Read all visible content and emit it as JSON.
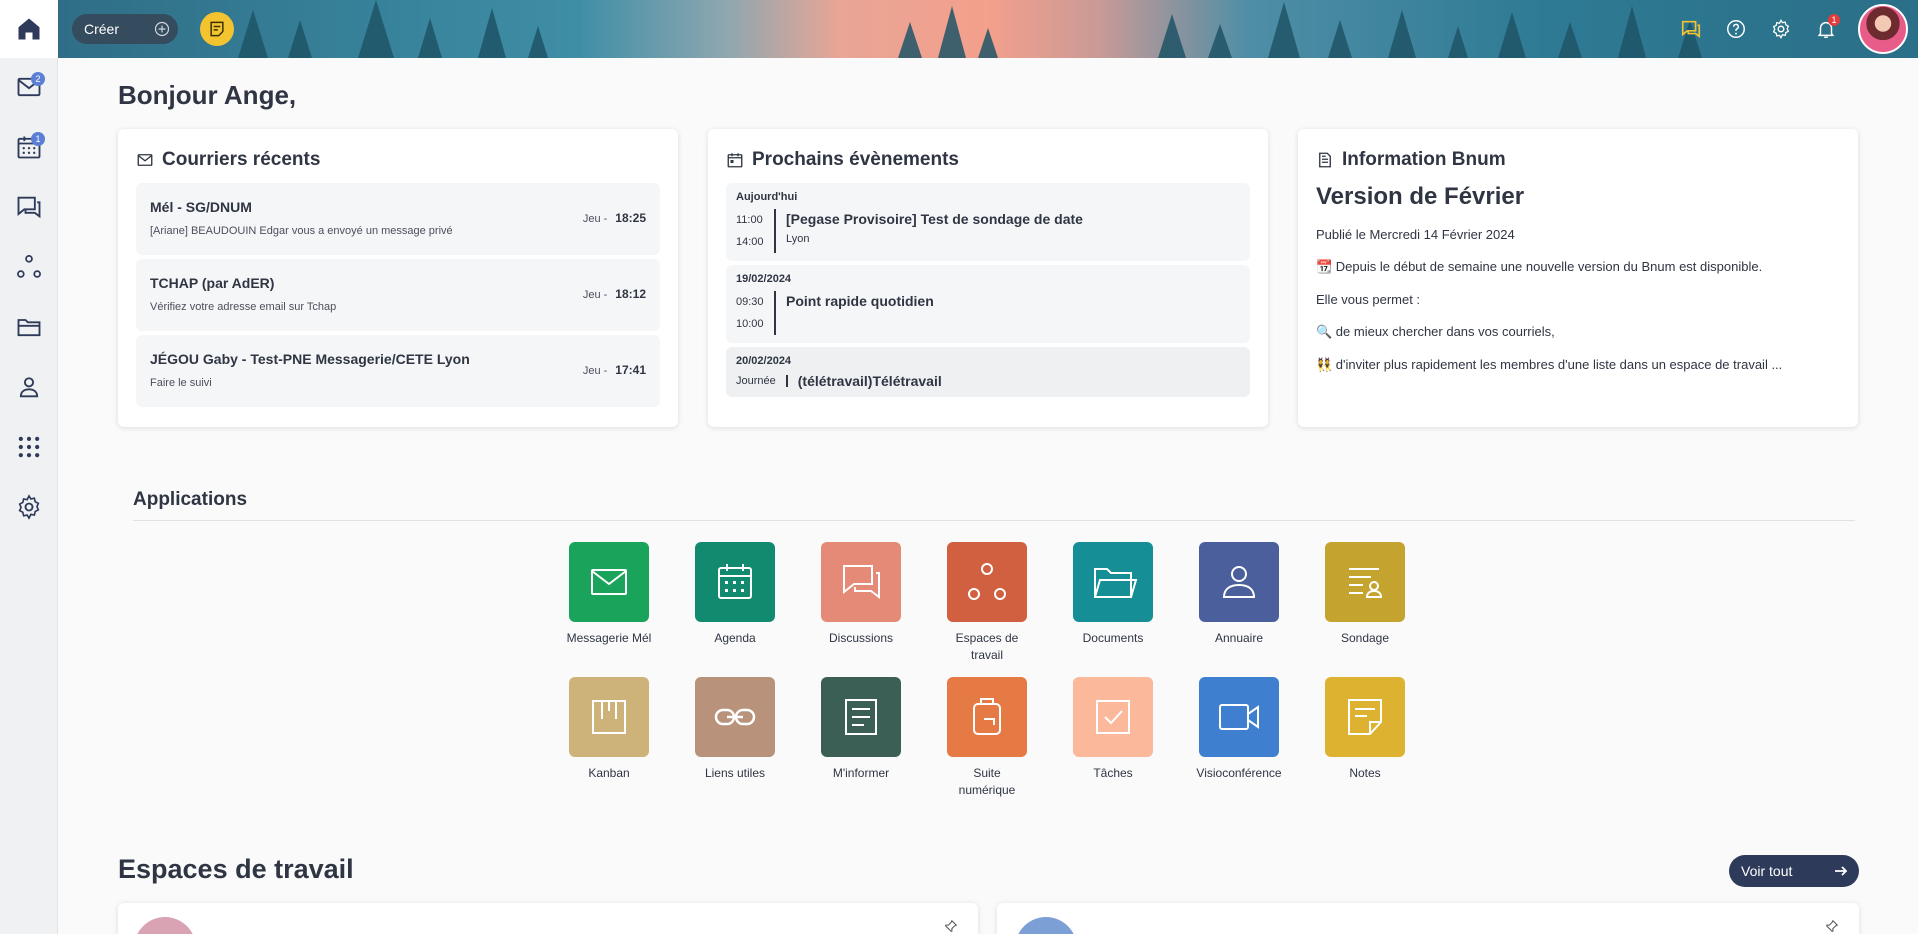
{
  "header": {
    "create_label": "Créer",
    "notification_count": "1"
  },
  "sidebar": {
    "mail_badge": "2",
    "calendar_badge": "1"
  },
  "greeting": "Bonjour Ange,",
  "mails": {
    "title": "Courriers récents",
    "items": [
      {
        "from": "Mél - SG/DNUM",
        "subject": "[Ariane] BEAUDOUIN Edgar vous a envoyé un message privé",
        "day": "Jeu -",
        "time": "18:25"
      },
      {
        "from": "TCHAP (par AdER)",
        "subject": "Vérifiez votre adresse email sur Tchap",
        "day": "Jeu -",
        "time": "18:12"
      },
      {
        "from": "JÉGOU Gaby - Test-PNE Messagerie/CETE Lyon",
        "subject": "Faire le suivi",
        "day": "Jeu -",
        "time": "17:41"
      }
    ]
  },
  "events": {
    "title": "Prochains évènements",
    "items": [
      {
        "day": "Aujourd'hui",
        "start": "11:00",
        "end": "14:00",
        "name": "[Pegase Provisoire] Test de sondage de date",
        "location": "Lyon"
      },
      {
        "day": "19/02/2024",
        "start": "09:30",
        "end": "10:00",
        "name": "Point rapide quotidien",
        "location": ""
      },
      {
        "day": "20/02/2024",
        "allday_label": "Journée",
        "name": "(télétravail)Télétravail"
      }
    ]
  },
  "info": {
    "title": "Information Bnum",
    "version": "Version de Février",
    "published": "Publié le Mercredi 14 Février 2024",
    "line1": "📆 Depuis le début de semaine une nouvelle version du Bnum est disponible.",
    "line2": "Elle vous permet :",
    "line3": "🔍 de mieux chercher dans vos courriels,",
    "line4": "👯 d'inviter plus rapidement les membres d'une liste dans un espace de travail ..."
  },
  "applications": {
    "title": "Applications",
    "items": [
      {
        "label": "Messagerie Mél",
        "icon": "mail-icon",
        "color": "#1aa35a"
      },
      {
        "label": "Agenda",
        "icon": "calendar-icon",
        "color": "#128a70"
      },
      {
        "label": "Discussions",
        "icon": "chat-icon",
        "color": "#e58a76"
      },
      {
        "label": "Espaces de travail",
        "icon": "workspace-icon",
        "color": "#d0603f"
      },
      {
        "label": "Documents",
        "icon": "folder-icon",
        "color": "#168e95"
      },
      {
        "label": "Annuaire",
        "icon": "user-icon",
        "color": "#4a5f9c"
      },
      {
        "label": "Sondage",
        "icon": "poll-icon",
        "color": "#c5a32f"
      },
      {
        "label": "Kanban",
        "icon": "kanban-icon",
        "color": "#cdb37a"
      },
      {
        "label": "Liens utiles",
        "icon": "link-icon",
        "color": "#b8927a"
      },
      {
        "label": "M'informer",
        "icon": "news-icon",
        "color": "#3c5f55"
      },
      {
        "label": "Suite numérique",
        "icon": "suite-icon",
        "color": "#e57a45"
      },
      {
        "label": "Tâches",
        "icon": "task-icon",
        "color": "#fbb89a"
      },
      {
        "label": "Visioconférence",
        "icon": "video-icon",
        "color": "#3f7fd0"
      },
      {
        "label": "Notes",
        "icon": "note-icon",
        "color": "#ddb230"
      }
    ]
  },
  "workspaces": {
    "title": "Espaces de travail",
    "see_all": "Voir tout"
  }
}
